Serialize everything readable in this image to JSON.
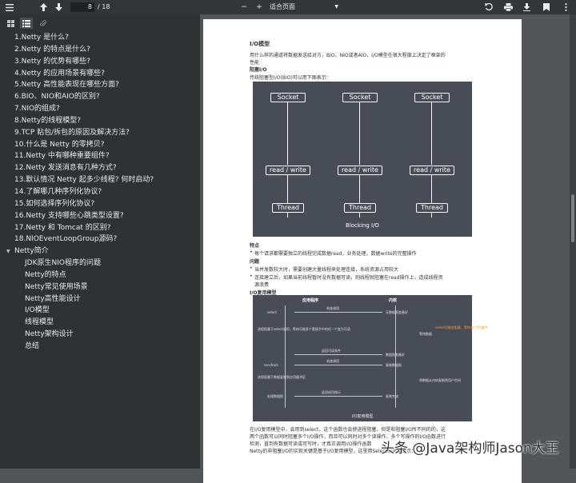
{
  "toolbar": {
    "page_current": "8",
    "page_total": "/ 18",
    "zoom_label": "适合页面",
    "minus": "−",
    "plus": "+"
  },
  "sidebar": {
    "outline": [
      "1.Netty 是什么?",
      "2.Netty 的特点是什么?",
      "3.Netty 的优势有哪些?",
      "4.Netty 的应用场景有哪些?",
      "5.Netty 高性能表现在哪些方面?",
      "6.BIO、NIO和AIO的区别?",
      "7.NIO的组成?",
      "8.Netty的线程模型?",
      "9.TCP 粘包/拆包的原因及解决方法?",
      "10.什么是 Netty 的零拷贝?",
      "11.Netty 中有哪种重要组件?",
      "12.Netty 发送消息有几种方式?",
      "13.默认情况 Netty 起多少线程? 何时启动?",
      "14.了解哪几种序列化协议?",
      "15.如何选择序列化协议?",
      "16.Netty 支持哪些心跳类型设置?",
      "17.Netty 和 Tomcat 的区别?",
      "18.NIOEventLoopGroup源码?"
    ],
    "parent": "Netty简介",
    "children": [
      "JDK原生NIO程序的问题",
      "Netty的特点",
      "Netty常见使用场景",
      "Netty高性能设计",
      "I/O模型",
      "线程模型",
      "Netty架构设计",
      "总结"
    ]
  },
  "doc": {
    "heading": "I/O模型",
    "intro1": "用什么样的通道将数据发送给对方，BIO、NIO或者AIO，I/O模型在很大程度上决定了框架的",
    "intro2": "性能",
    "blocking_title": "阻塞I/O",
    "blocking_desc": "传统阻塞型I/O(BIO)可以用下图表示：",
    "diagram1": {
      "socket": "Socket",
      "rw": "read / write",
      "thread": "Thread",
      "caption": "Blocking I/O"
    },
    "features_title": "特点",
    "feature1": "每个请求都需要独立的线程完成数据read，业务处理，数据write的完整操作",
    "problems_title": "问题",
    "problem1": "当并发数较大时，需要创建大量线程来处理连接，系统资源占用较大",
    "problem2a": "连接建立后，如果当前线程暂时没有数据可读，则线程就阻塞在read操作上，造成线程资",
    "problem2b": "源浪费",
    "mux_title": "I/O复用模型",
    "diagram2": {
      "app": "应用程序",
      "kernel": "内核",
      "select": "select",
      "recvfrom": "recvfrom",
      "no_data": "无数据报准备好",
      "ready": "数据报准备好",
      "copy": "复制数据报",
      "done": "复制完成",
      "process": "处理数据报",
      "syscall": "系统调用",
      "return_ready": "返回可读条件",
      "return_ok": "返回成功指示",
      "wait": "等待数据",
      "copy_k2u": "将数据从内核复制到用户空间",
      "block1": "进程阻塞于select调用，等待可能多个套接字中的任一个变为可读",
      "block2": "进程阻塞于数据复制到应用缓冲区",
      "note": "select可能会阻塞，等待多个I/O事件",
      "caption": "I/O复用模型"
    },
    "body1": "在I/O复用模型中，会用到select，这个函数也会使进程阻塞，但是和阻塞I/O所不同的的，这",
    "body2": "两个函数可以同时阻塞多个I/O操作，而且可以同时对多个读操作、多个写操作的I/O函数进行",
    "body3": "检测，直到有数据可读或可写时，才真正调用I/O操作函数",
    "body4": "Netty的非阻塞I/O的实现关键是基于I/O复用模型，这里用Selector对象表示："
  },
  "watermark": "头条 @Java架构师Jason大王"
}
